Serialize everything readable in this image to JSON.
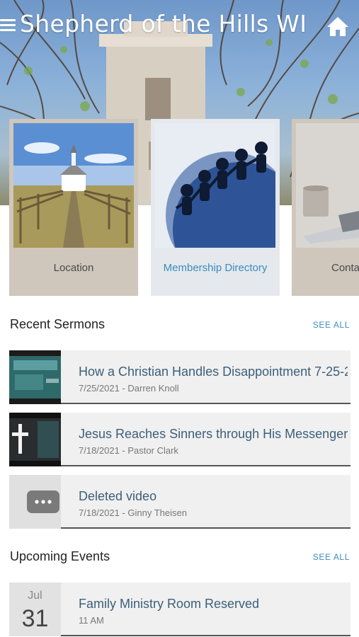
{
  "header": {
    "title": "Shepherd of the Hills WI",
    "menu_icon": "hamburger-menu-icon",
    "home_icon": "home-icon"
  },
  "cards": [
    {
      "label": "Location",
      "icon": "church-road-photo"
    },
    {
      "label": "Membership Directory",
      "icon": "people-globe-photo"
    },
    {
      "label": "Conta",
      "icon": "laptop-mug-photo"
    }
  ],
  "sermons": {
    "title": "Recent Sermons",
    "see_all": "SEE ALL",
    "items": [
      {
        "title": "How a Christian Handles Disappointment 7-25-2",
        "subtitle": "7/25/2021 - Darren Knoll"
      },
      {
        "title": "Jesus Reaches Sinners through His Messengers",
        "subtitle": "7/18/2021 - Pastor Clark"
      },
      {
        "title": "Deleted video",
        "subtitle": "7/18/2021 - Ginny Theisen"
      }
    ]
  },
  "events": {
    "title": "Upcoming Events",
    "see_all": "SEE ALL",
    "items": [
      {
        "month": "Jul",
        "day": "31",
        "title": "Family Ministry Room Reserved",
        "subtitle": "11 AM"
      }
    ]
  },
  "colors": {
    "accent": "#3a8cc0",
    "card_bg": "#cfc6bc",
    "row_bg": "#f0f0f0",
    "row_title": "#3b5f7a"
  }
}
